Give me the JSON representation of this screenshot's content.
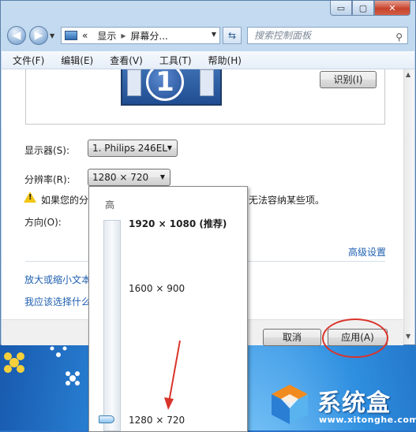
{
  "window": {
    "caption": {
      "minimize": "▭",
      "maximize": "▢",
      "close": "✕"
    }
  },
  "nav": {
    "back_icon": "arrow-left-icon",
    "forward_icon": "arrow-right-icon",
    "address": {
      "prefix": "«",
      "crumb1": "显示",
      "crumb2": "屏幕分..."
    },
    "refresh_icon": "refresh-icon",
    "search_placeholder": "搜索控制面板"
  },
  "menubar": [
    "文件(F)",
    "编辑(E)",
    "查看(V)",
    "工具(T)",
    "帮助(H)"
  ],
  "monitor": {
    "number": "1"
  },
  "identify_button": "识别(I)",
  "display": {
    "label": "显示器(S):",
    "value": "1. Philips 246EL"
  },
  "resolution": {
    "label": "分辨率(R):",
    "value": "1280 × 720"
  },
  "warning": {
    "text_left": "如果您的分",
    "text_right": "无法容纳某些项。"
  },
  "orientation": {
    "label": "方向(O):"
  },
  "advanced_link": "高级设置",
  "links": [
    "放大或缩小文本",
    "我应该选择什么"
  ],
  "buttons": {
    "cancel": "取消",
    "apply": "应用(A)"
  },
  "dropdown": {
    "high_label": "高",
    "options": [
      {
        "label": "1920 × 1080 (推荐)",
        "bold": true
      },
      {
        "label": "1600 × 900",
        "bold": false
      },
      {
        "label": "1280 × 720",
        "bold": false
      }
    ],
    "selected": "1280 × 720"
  },
  "watermark": {
    "name": "系统盒",
    "url": "www.xitonghe.com"
  },
  "colors": {
    "link": "#1f5fb0",
    "annotation": "#d9342b",
    "warning": "#f2c511"
  }
}
